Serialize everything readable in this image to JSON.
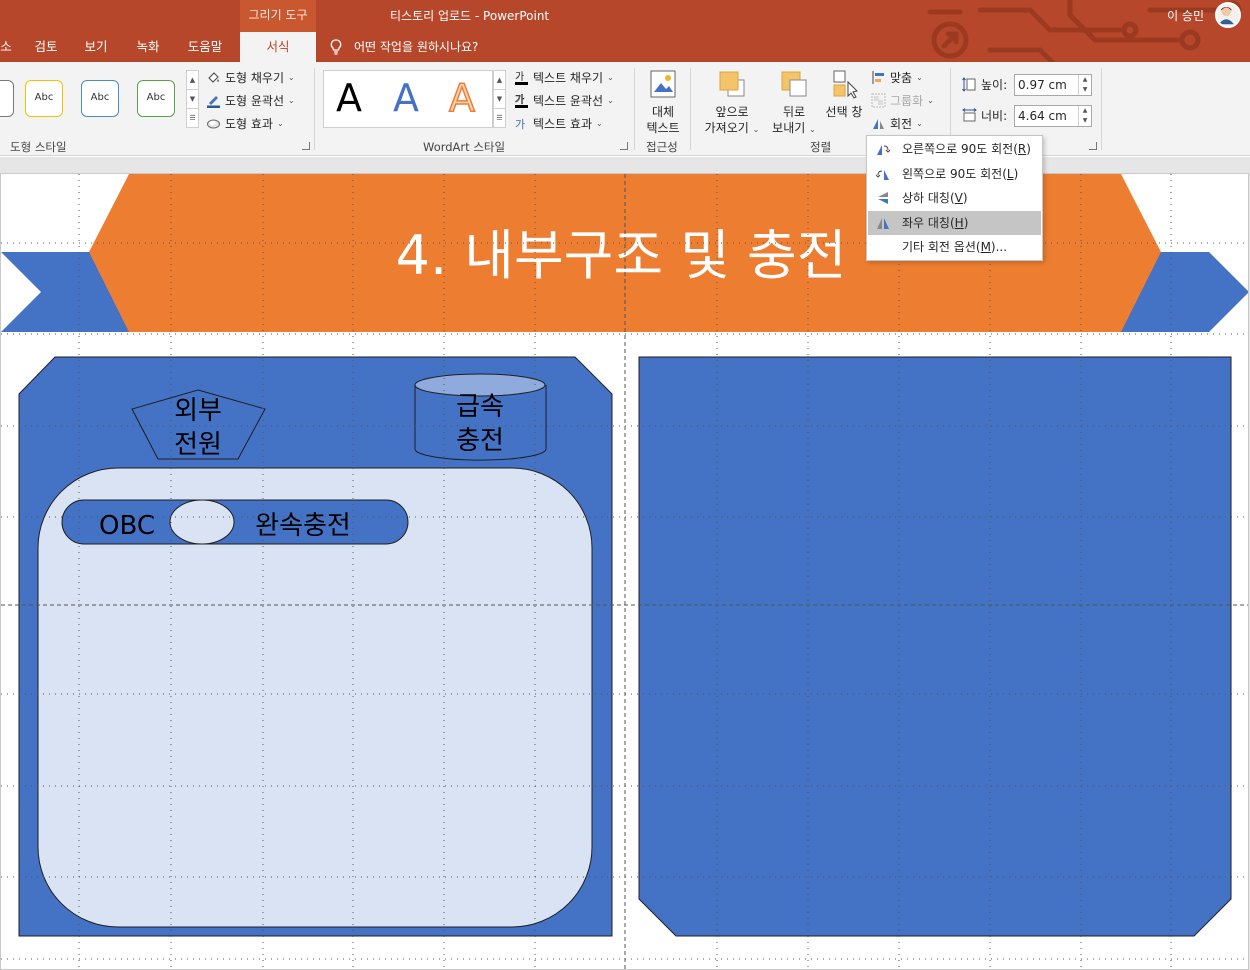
{
  "window": {
    "title": "티스토리 업로드  -  PowerPoint",
    "context_group": "그리기 도구",
    "user": "이 승민"
  },
  "tabs": [
    {
      "label": "소",
      "active": false
    },
    {
      "label": "검토",
      "active": false
    },
    {
      "label": "보기",
      "active": false
    },
    {
      "label": "녹화",
      "active": false
    },
    {
      "label": "도움말",
      "active": false
    },
    {
      "label": "서식",
      "active": true
    }
  ],
  "tell_me": "어떤 작업을 원하시나요?",
  "shape_styles": {
    "label": "도형 스타일",
    "samples": [
      {
        "text": "Abc",
        "border": "#f2c200"
      },
      {
        "text": "Abc",
        "border": "#4a8cc8"
      },
      {
        "text": "Abc",
        "border": "#5aa346"
      }
    ],
    "fill": "도형 채우기",
    "outline": "도형 윤곽선",
    "effects": "도형 효과"
  },
  "wordart": {
    "label": "WordArt 스타일",
    "letters": [
      {
        "text": "A",
        "style": "black"
      },
      {
        "text": "A",
        "style": "blue"
      },
      {
        "text": "A",
        "style": "orange-outline"
      }
    ],
    "text_fill": "텍스트 채우기",
    "text_outline": "텍스트 윤곽선",
    "text_effects": "텍스트 효과"
  },
  "accessibility": {
    "label": "접근성",
    "alt_text_line1": "대체",
    "alt_text_line2": "텍스트"
  },
  "arrange": {
    "label": "정렬",
    "bring_forward_line1": "앞으로",
    "bring_forward_line2": "가져오기",
    "send_backward_line1": "뒤로",
    "send_backward_line2": "보내기",
    "selection_pane": "선택 창",
    "align": "맞춤",
    "group": "그룹화",
    "rotate": "회전"
  },
  "size": {
    "height_label": "높이:",
    "height_value": "0.97 cm",
    "width_label": "너비:",
    "width_value": "4.64 cm"
  },
  "rotate_menu": [
    {
      "label": "오른쪽으로 90도 회전",
      "key": "R",
      "hover": false
    },
    {
      "label": "왼쪽으로 90도 회전",
      "key": "L",
      "hover": false
    },
    {
      "label": "상하 대칭",
      "key": "V",
      "hover": false
    },
    {
      "label": "좌우 대칭",
      "key": "H",
      "hover": true
    },
    {
      "label": "기타 회전 옵션",
      "key": "M",
      "hover": false,
      "suffix": "..."
    }
  ],
  "slide": {
    "title": "4. 내부구조 및 충전",
    "external_power_line1": "외부",
    "external_power_line2": "전원",
    "fast_charge_line1": "급속",
    "fast_charge_line2": "충전",
    "obc": "OBC",
    "slow_charge": "완속충전",
    "colors": {
      "ribbon_accent": "#b7472a",
      "banner": "#ed7d31",
      "blue": "#4472c4",
      "light": "#dae3f3"
    }
  }
}
